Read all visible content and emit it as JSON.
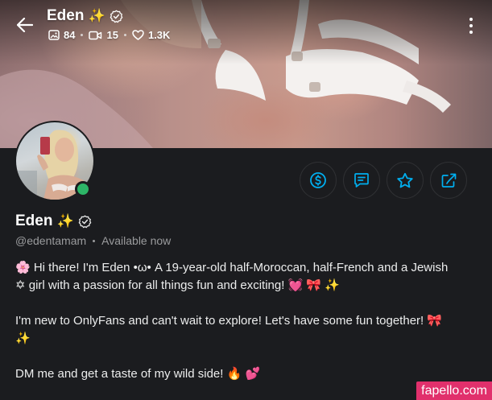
{
  "header": {
    "name": "Eden",
    "name_emoji": "✨",
    "stats": [
      {
        "icon": "image-icon",
        "value": "84"
      },
      {
        "icon": "video-icon",
        "value": "15"
      },
      {
        "icon": "heart-icon",
        "value": "1.3K"
      }
    ]
  },
  "profile": {
    "name": "Eden",
    "name_emoji": "✨",
    "handle": "@edentamam",
    "status": "Available now",
    "online": true
  },
  "actions": [
    {
      "icon": "tip-dollar-icon",
      "name": "tip-button"
    },
    {
      "icon": "message-icon",
      "name": "message-button"
    },
    {
      "icon": "star-icon",
      "name": "favorite-button"
    },
    {
      "icon": "share-icon",
      "name": "share-button"
    }
  ],
  "bio": {
    "line1": "🌸 Hi there! I'm Eden •ω• A 19-year-old half-Moroccan, half-French and a Jewish",
    "line2": "✡ girl with a passion for all things fun and exciting! 💓 🎀 ✨",
    "line3": "I'm new to OnlyFans and can't wait to explore! Let's have some fun together! 🎀",
    "line4": "✨",
    "line5": "DM me and get a taste of my wild side! 🔥 💕"
  },
  "watermark": "fapello.com",
  "colors": {
    "accent": "#00aff0",
    "online": "#2db567",
    "background": "#1b1c1f",
    "muted_text": "#9a9b9d"
  }
}
